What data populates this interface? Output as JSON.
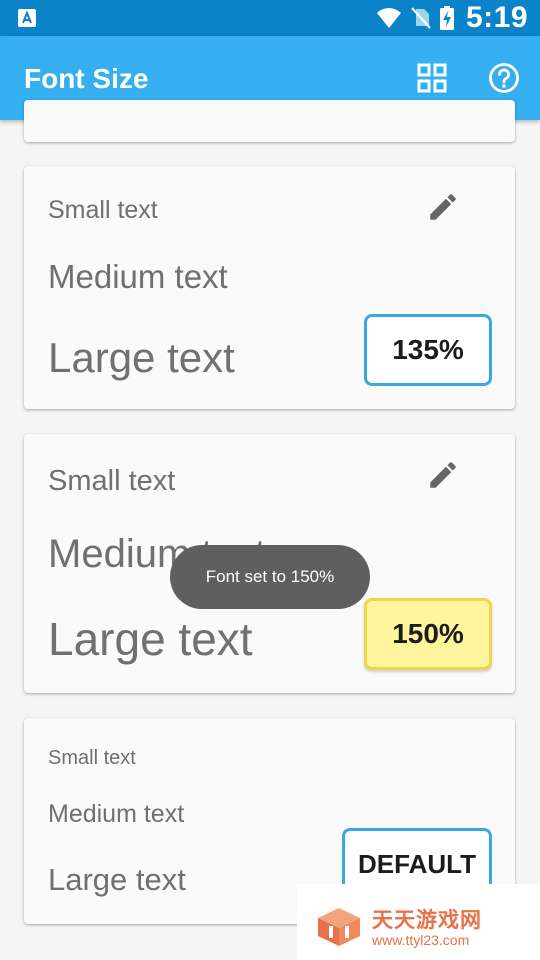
{
  "status_bar": {
    "time": "5:19",
    "icons": [
      "notification-icon",
      "wifi-icon",
      "no-sim-icon",
      "battery-charging-icon"
    ]
  },
  "app_bar": {
    "title": "Font Size",
    "actions": [
      "grid-view-icon",
      "help-icon"
    ]
  },
  "cards": [
    {
      "small": "Small text",
      "medium": "Medium text",
      "large": "Large text",
      "percent": "135%",
      "style": "outlined-blue",
      "has_edit": true
    },
    {
      "small": "Small text",
      "medium": "Medium text",
      "large": "Large text",
      "percent": "150%",
      "style": "selected-yellow",
      "has_edit": true
    },
    {
      "small": "Small text",
      "medium": "Medium text",
      "large": "Large text",
      "percent": "DEFAULT",
      "style": "outlined-blue",
      "has_edit": false
    }
  ],
  "toast": "Font set to 150%",
  "watermark": {
    "brand": "天天游戏网",
    "url": "www.ttyl23.com"
  },
  "colors": {
    "status_bar": "#0b83c9",
    "app_bar": "#36aff0",
    "accent_border": "#3aa8e0",
    "selected_fill": "#fff59d",
    "selected_border": "#f2d44c",
    "watermark": "#e8714a"
  }
}
